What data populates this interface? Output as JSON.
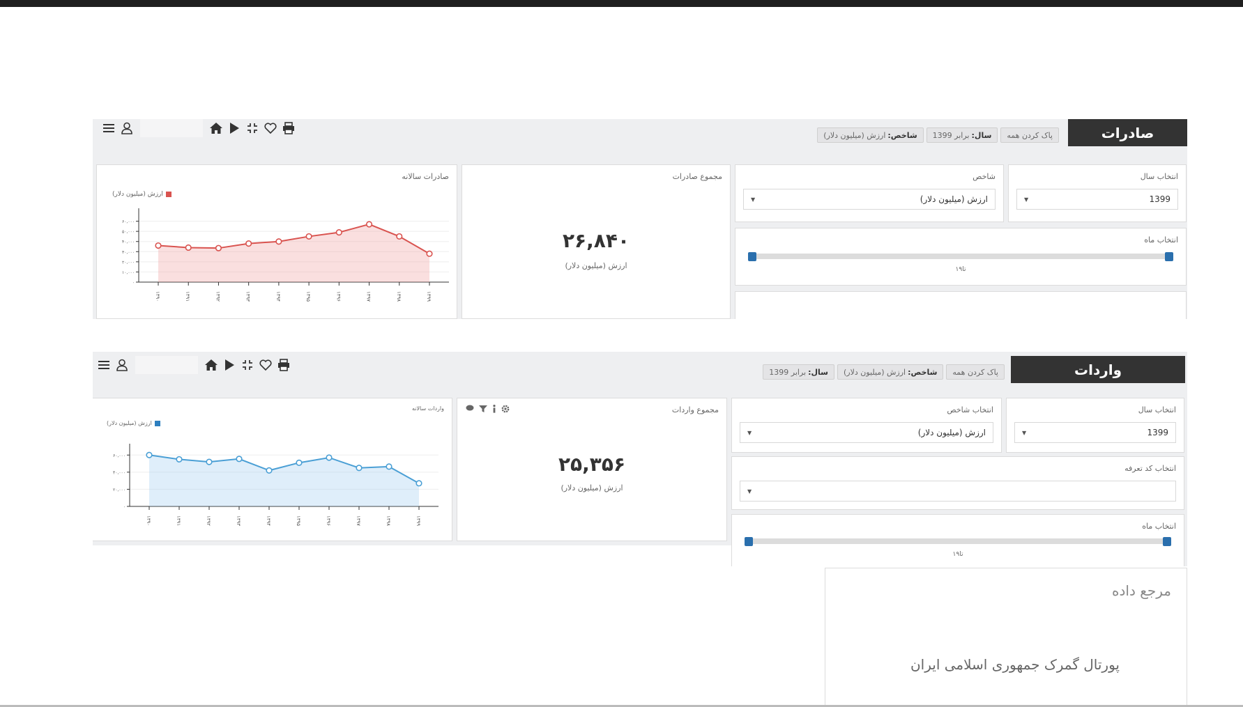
{
  "exports": {
    "title": "صادرات",
    "chips": {
      "clear_all": "پاک کردن همه",
      "year_key": "سال:",
      "year_val": "برابر 1399",
      "index_key": "شاخص:",
      "index_val": "ارزش (میلیون دلار)"
    },
    "year_card": {
      "label": "انتخاب سال",
      "value": "1399"
    },
    "index_card": {
      "label": "شاخص",
      "value": "ارزش (میلیون دلار)"
    },
    "month_card": {
      "label": "انتخاب ماه",
      "slider_value": "۱تا۹"
    },
    "total_card": {
      "label": "مجموع صادرات",
      "value": "۲۶,۸۴۰",
      "unit": "(میلیون دلار) ارزش"
    },
    "chart_card": {
      "label": "صادرات سالانه"
    }
  },
  "imports": {
    "title": "واردات",
    "chips": {
      "clear_all": "پاک کردن همه",
      "index_key": "شاخص:",
      "index_val": "ارزش (میلیون دلار)",
      "year_key": "سال:",
      "year_val": "برابر 1399"
    },
    "year_card": {
      "label": "انتخاب سال",
      "value": "1399"
    },
    "index_card": {
      "label": "انتخاب شاخص",
      "value": "ارزش (میلیون دلار)"
    },
    "tariff_card": {
      "label": "انتخاب کد تعرفه",
      "value": ""
    },
    "month_card": {
      "label": "انتخاب ماه",
      "slider_value": "۱تا۹"
    },
    "total_card": {
      "label": "مجموع واردات",
      "value": "۲۵,۳۵۶",
      "unit": "(میلیون دلار) ارزش"
    },
    "chart_card": {
      "label": "واردات سالانه"
    }
  },
  "data_source": {
    "title": "مرجع داده",
    "source": "پورتال گمرک جمهوری اسلامی ایران"
  },
  "icons": {
    "toolbar": [
      "menu-icon",
      "user-icon",
      "home-icon",
      "play-icon",
      "compress-icon",
      "heart-icon",
      "print-icon"
    ],
    "chart_tools": [
      "comment-icon",
      "filter-icon",
      "info-icon",
      "gear-icon"
    ]
  },
  "colors": {
    "exports_series": "#d9534f",
    "imports_series": "#4a9fd5",
    "title_bg": "#333333",
    "slider_handle": "#2a6fad"
  },
  "chart_data": [
    {
      "type": "area",
      "title": "صادرات سالانه",
      "categories": [
        "۱۳۹۰",
        "۱۳۹۱",
        "۱۳۹۲",
        "۱۳۹۳",
        "۱۳۹۴",
        "۱۳۹۵",
        "۱۳۹۶",
        "۱۳۹۷",
        "۱۳۹۸",
        "۱۳۹۹"
      ],
      "series": [
        {
          "name": "ارزش (میلیون دلار)",
          "values": [
            36000,
            34000,
            33500,
            38000,
            40000,
            45000,
            49000,
            57000,
            45000,
            28000
          ]
        }
      ],
      "ylim": [
        0,
        70000
      ],
      "yticks": [
        0,
        10000,
        20000,
        30000,
        40000,
        50000,
        60000
      ],
      "ytick_labels": [
        "۰",
        "۱۰,۰۰۰",
        "۲۰,۰۰۰",
        "۳۰,۰۰۰",
        "۴۰,۰۰۰",
        "۵۰,۰۰۰",
        "۶۰,۰۰۰"
      ],
      "legend": "top-left",
      "grid": true
    },
    {
      "type": "area",
      "title": "واردات سالانه",
      "categories": [
        "۱۳۹۰",
        "۱۳۹۱",
        "۱۳۹۲",
        "۱۳۹۳",
        "۱۳۹۴",
        "۱۳۹۵",
        "۱۳۹۶",
        "۱۳۹۷",
        "۱۳۹۸",
        "۱۳۹۹"
      ],
      "series": [
        {
          "name": "ارزش (میلیون دلار)",
          "values": [
            60000,
            55000,
            52000,
            55500,
            42000,
            51000,
            57000,
            45000,
            46500,
            27000
          ]
        }
      ],
      "ylim": [
        0,
        70000
      ],
      "yticks": [
        0,
        20000,
        40000,
        60000
      ],
      "ytick_labels": [
        "۰",
        "۲۰,۰۰۰",
        "۴۰,۰۰۰",
        "۶۰,۰۰۰"
      ],
      "legend": "top-left",
      "grid": true
    }
  ]
}
